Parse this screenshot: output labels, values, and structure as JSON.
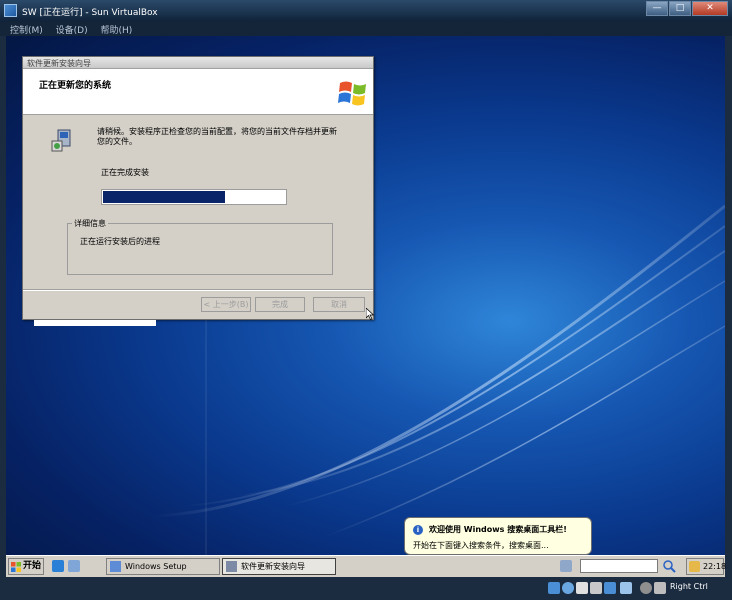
{
  "host": {
    "title": "SW [正在运行] - Sun VirtualBox",
    "menu": [
      "控制(M)",
      "设备(D)",
      "帮助(H)"
    ],
    "window_buttons": [
      "—",
      "□",
      "✕"
    ],
    "host_key": "Right Ctrl"
  },
  "installer": {
    "window_title": "软件更新安装向导",
    "header_title": "正在更新您的系统",
    "info_text": "请稍候。安装程序正检查您的当前配置，将您的当前文件存档并更新您的文件。",
    "status_text": "正在完成安装",
    "progress": 0.67,
    "details_legend": "详细信息",
    "details_text": "正在运行安装后的进程",
    "buttons": {
      "back": "< 上一步(B)",
      "finish": "完成",
      "cancel": "取消"
    }
  },
  "balloon": {
    "title": "欢迎使用 Windows 搜索桌面工具栏!",
    "text": "开始在下面键入搜索条件，搜索桌面..."
  },
  "taskbar": {
    "start": "开始",
    "tasks": [
      "Windows Setup",
      "软件更新安装向导"
    ],
    "clock": "22:18"
  },
  "colors": {
    "progress_fill": "#0a246a",
    "host_title_bar": "#0f2238",
    "desktop_blue": "#1657b2"
  }
}
